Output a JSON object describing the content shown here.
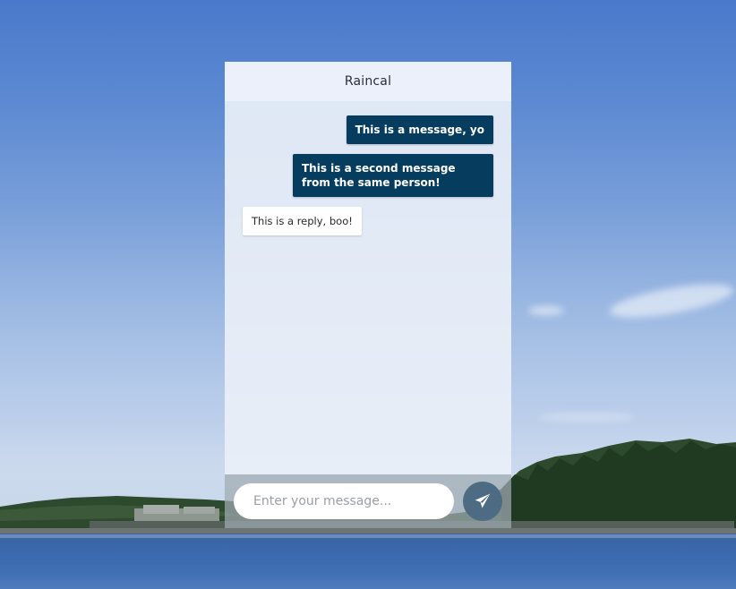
{
  "chat": {
    "title": "Raincal",
    "messages": [
      {
        "direction": "out",
        "text": "This is a message, yo"
      },
      {
        "direction": "out",
        "text": "This is a second message from the same person!"
      },
      {
        "direction": "in",
        "text": "This is a reply, boo!"
      }
    ],
    "input": {
      "placeholder": "Enter your message...",
      "value": ""
    },
    "send_icon": "paper-plane-icon"
  },
  "colors": {
    "outgoing_bubble": "#063c5e",
    "incoming_bubble": "#ffffff",
    "send_button": "#4e6b84"
  }
}
